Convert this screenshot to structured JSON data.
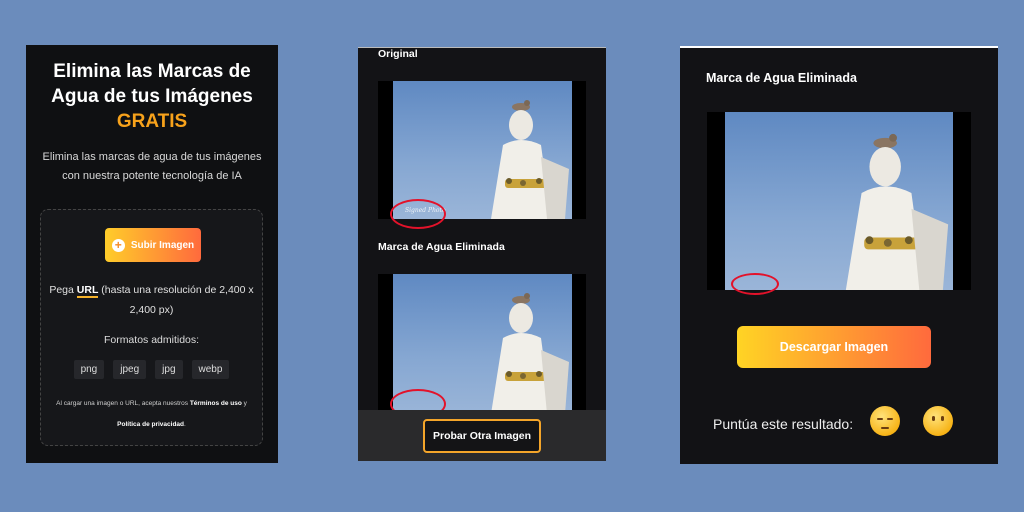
{
  "colors": {
    "background": "#6b8cbc",
    "panel": "#101114",
    "accent_start": "#ffcd2a",
    "accent_end": "#ff6a3d",
    "highlight_ring": "#e3122a"
  },
  "panel1": {
    "headline_line1": "Elimina las Marcas de",
    "headline_line2": "Agua de tus Imágenes",
    "headline_highlight": "GRATIS",
    "subtitle": "Elimina las marcas de agua de tus imágenes con nuestra potente tecnología de IA",
    "upload_button": "Subir Imagen",
    "paste_prefix": "Pega",
    "paste_url": "URL",
    "paste_suffix": "(hasta una resolución de 2,400 x 2,400 px)",
    "formats_label": "Formatos admitidos:",
    "formats": [
      "png",
      "jpeg",
      "jpg",
      "webp"
    ],
    "legal_prefix": "Al cargar una imagen o URL, acepta nuestros",
    "legal_terms": "Términos de uso",
    "legal_and": "y",
    "legal_privacy": "Política de privacidad",
    "legal_end": "."
  },
  "panel2": {
    "original_label": "Original",
    "removed_label": "Marca de Agua Eliminada",
    "try_button": "Probar Otra Imagen"
  },
  "panel3": {
    "title": "Marca de Agua Eliminada",
    "download_button": "Descargar Imagen",
    "rate_label": "Puntúa este resultado:",
    "icons": [
      "pensive-face-icon",
      "neutral-face-icon"
    ]
  }
}
